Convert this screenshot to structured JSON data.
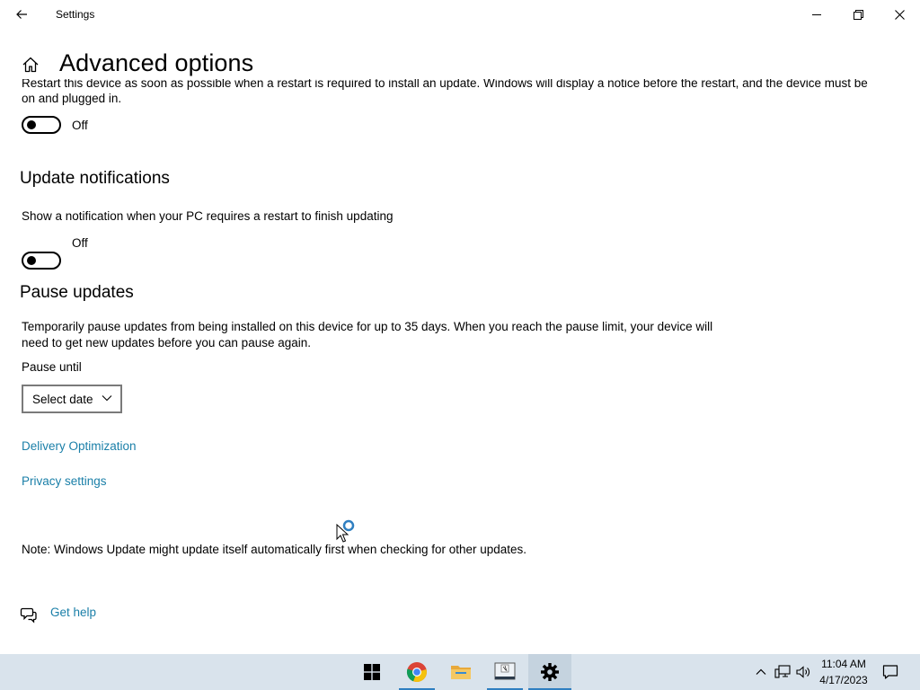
{
  "window": {
    "title": "Settings"
  },
  "header": {
    "page_title": "Advanced options"
  },
  "restart_section": {
    "clipped_text": "Restart this device as soon as possible when a restart is required to install an update. Windows will display a notice before the restart, and the device must be",
    "text_line2": "on and plugged in.",
    "toggle_state": "Off"
  },
  "update_notifications": {
    "title": "Update notifications",
    "description": "Show a notification when your PC requires a restart to finish updating",
    "toggle_state": "Off"
  },
  "pause_updates": {
    "title": "Pause updates",
    "description_line1": "Temporarily pause updates from being installed on this device for up to 35 days. When you reach the pause limit, your device will",
    "description_line2": "need to get new updates before you can pause again.",
    "pause_until_label": "Pause until",
    "dropdown_value": "Select date"
  },
  "links": {
    "delivery_optimization": "Delivery Optimization",
    "privacy_settings": "Privacy settings"
  },
  "note": "Note: Windows Update might update itself automatically first when checking for other updates.",
  "help": {
    "get_help": "Get help"
  },
  "taskbar": {
    "apps": [
      "start-icon",
      "chrome-icon",
      "file-explorer-icon",
      "app-window-icon",
      "settings-icon"
    ],
    "time": "11:04 AM",
    "date": "4/17/2023"
  },
  "colors": {
    "link": "#1a7fa8",
    "taskbar": "#d9e3ec",
    "accent": "#2f7fc1"
  }
}
